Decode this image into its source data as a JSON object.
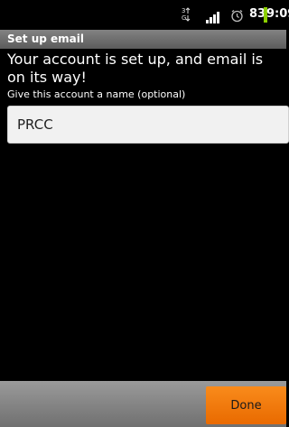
{
  "status_bar": {
    "data_indicator": "3G",
    "battery_percent": "83",
    "time": "9:09",
    "battery_color": "#8bcf00",
    "icons": [
      "data-arrows-icon",
      "signal-icon",
      "alarm-icon",
      "battery-icon"
    ]
  },
  "title_bar": {
    "title": "Set up email"
  },
  "main": {
    "headline": "Your account is set up, and email is on its way!",
    "name_label": "Give this account a name (optional)",
    "name_value": "PRCC"
  },
  "bottom_bar": {
    "done_label": "Done",
    "done_color": "#f57f0e"
  }
}
